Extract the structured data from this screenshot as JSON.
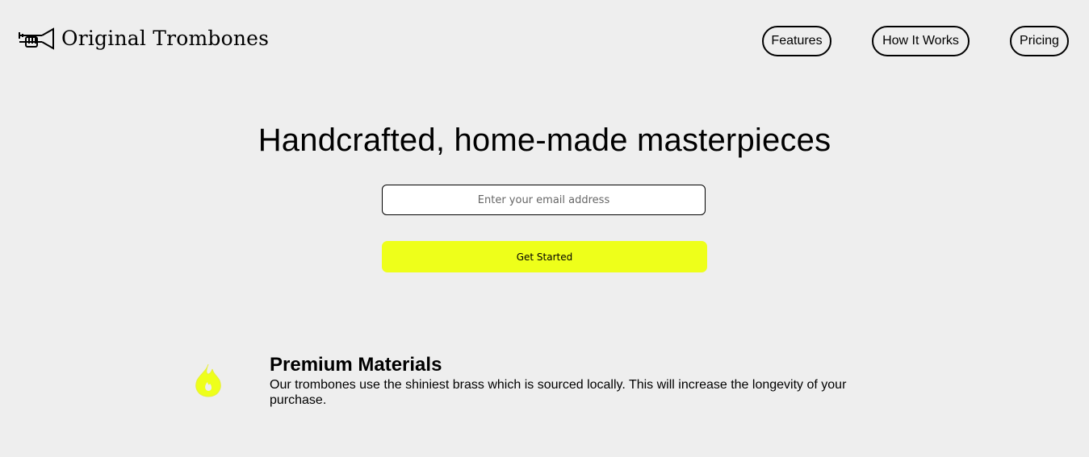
{
  "header": {
    "brand_name": "Original Trombones",
    "logo_icon": "trumpet-icon",
    "nav": [
      {
        "label": "Features"
      },
      {
        "label": "How It Works"
      },
      {
        "label": "Pricing"
      }
    ]
  },
  "hero": {
    "title": "Handcrafted, home-made masterpieces",
    "email_placeholder": "Enter your email address",
    "cta_label": "Get Started"
  },
  "features": [
    {
      "icon": "flame-icon",
      "title": "Premium Materials",
      "text": "Our trombones use the shiniest brass which is sourced locally. This will increase the longevity of your purchase."
    }
  ],
  "colors": {
    "background": "#eeeeee",
    "accent": "#eeff1a",
    "text": "#000000"
  }
}
